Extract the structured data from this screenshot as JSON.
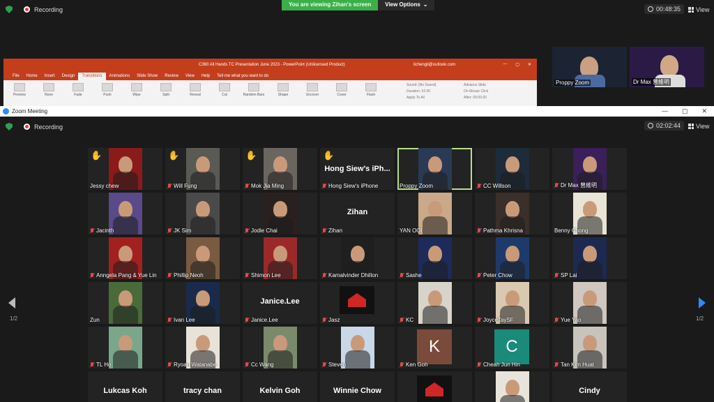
{
  "outer": {
    "recording": "Recording",
    "banner_text": "You are viewing Zihan's screen",
    "view_options": "View Options",
    "view_options_caret": "⌄",
    "timer": "00:48:35",
    "view": "View"
  },
  "ppt": {
    "title": "C360 All Hands TC Presentation June 2023 - PowerPoint (Unlicensed Product)",
    "account": "lichengli@outlook.com",
    "menu": [
      "File",
      "Home",
      "Insert",
      "Design",
      "Transitions",
      "Animations",
      "Slide Show",
      "Review",
      "View",
      "Help",
      "Tell me what you want to do"
    ],
    "ribbon": [
      "Preview",
      "None",
      "Fade",
      "Push",
      "Wipe",
      "Split",
      "Reveal",
      "Cut",
      "Random Bars",
      "Shape",
      "Uncover",
      "Cover",
      "Flash"
    ],
    "opts_sound": "Sound: [No Sound]",
    "opts_duration": "Duration: 02.00",
    "opts_apply": "Apply To All",
    "opts_advance": "Advance Slide",
    "opts_mouse": "On Mouse Click",
    "opts_after": "After: 00:00.00",
    "share": "Share"
  },
  "mini_tiles": [
    {
      "name": "Proppy Zoom"
    },
    {
      "name": "Dr Max 曾維明"
    }
  ],
  "zoom": {
    "window_title": "Zoom Meeting",
    "recording": "Recording",
    "timer": "02:02:44",
    "view": "View",
    "page_left": "1/2",
    "page_right": "1/2"
  },
  "participants": [
    {
      "name": "Jessy chew",
      "hand": true,
      "muted": false,
      "bg": "#8b1a1a"
    },
    {
      "name": "Will Fung",
      "hand": true,
      "muted": true,
      "bg": "#5a5a55"
    },
    {
      "name": "Mok Jia Ming",
      "hand": true,
      "muted": true,
      "bg": "#6b6560"
    },
    {
      "name": "Hong Siew's iPhone",
      "hand": true,
      "muted": true,
      "big": "Hong Siew's iPh..."
    },
    {
      "name": "Proppy Zoom",
      "hand": false,
      "muted": false,
      "bg": "#2a3a55",
      "speaking": true
    },
    {
      "name": "CC Willson",
      "hand": false,
      "muted": true,
      "bg": "#1e2b3b"
    },
    {
      "name": "Dr Max 曾維明",
      "hand": false,
      "muted": true,
      "bg": "#3a1f5a"
    },
    {
      "name": "Jacinth",
      "muted": true,
      "bg": "#5a4a8a"
    },
    {
      "name": "JK Sim",
      "muted": true,
      "bg": "#4a4a4a"
    },
    {
      "name": "Jodie Chai",
      "muted": true,
      "bg": "#2b2020"
    },
    {
      "name": "Zihan",
      "muted": true,
      "big": "Zihan"
    },
    {
      "name": "YAN OOI",
      "muted": false,
      "bg": "#c9a98a"
    },
    {
      "name": "Pathma Khrisna",
      "muted": true,
      "bg": "#3a2f2a"
    },
    {
      "name": "Benny Chong",
      "muted": false,
      "bg": "#e9e4d6"
    },
    {
      "name": "Anngela Pang & Yue Lin",
      "muted": true,
      "bg": "#a32020"
    },
    {
      "name": "Phillip Neoh",
      "muted": true,
      "bg": "#7a5a40"
    },
    {
      "name": "Shimon Lee",
      "muted": true,
      "bg": "#9a2a2a"
    },
    {
      "name": "Kamalvinder Dhillon",
      "muted": true,
      "bg": "#1f1f1f"
    },
    {
      "name": "Sashe",
      "muted": true,
      "bg": "#1d2a5a"
    },
    {
      "name": "Peter Chow",
      "muted": true,
      "bg": "#1e3a6a"
    },
    {
      "name": "SP Lai",
      "muted": true,
      "bg": "#1d2950"
    },
    {
      "name": "Zun",
      "muted": false,
      "bg": "#4a6a3a"
    },
    {
      "name": "Ivan Lee",
      "muted": true,
      "bg": "#1a2a4a"
    },
    {
      "name": "Janice.Lee",
      "muted": true,
      "big": "Janice.Lee"
    },
    {
      "name": "Jasz",
      "muted": true,
      "logo": true
    },
    {
      "name": "KC",
      "muted": true,
      "bg": "#d8d4cc"
    },
    {
      "name": "JoyceTaySF",
      "muted": true,
      "bg": "#d9c9b0"
    },
    {
      "name": "Yue Yao",
      "muted": true,
      "bg": "#cfc7c0"
    },
    {
      "name": "TL Ho",
      "muted": true,
      "bg": "#7aa68a"
    },
    {
      "name": "Ryoan Watanabe",
      "muted": true,
      "bg": "#e8e2d8"
    },
    {
      "name": "Cc Wang",
      "muted": true,
      "bg": "#7a8a6a"
    },
    {
      "name": "Steven",
      "muted": true,
      "bg": "#c8d8e8"
    },
    {
      "name": "Ken Goh",
      "muted": true,
      "letter": "K",
      "lettercolor": "#7a4a3a"
    },
    {
      "name": "Cheah Jun Hin",
      "muted": true,
      "letter": "C",
      "lettercolor": "#1a8a7a"
    },
    {
      "name": "Tan Kim Huat",
      "muted": true,
      "bg": "#c8c4bc"
    },
    {
      "name": "",
      "big": "Lukcas Koh"
    },
    {
      "name": "",
      "big": "tracy chan"
    },
    {
      "name": "",
      "big": "Kelvin Goh"
    },
    {
      "name": "",
      "big": "Winnie Chow"
    },
    {
      "name": "",
      "logo": true
    },
    {
      "name": "",
      "bg": "#e8e4dc"
    },
    {
      "name": "",
      "big": "Cindy"
    }
  ]
}
